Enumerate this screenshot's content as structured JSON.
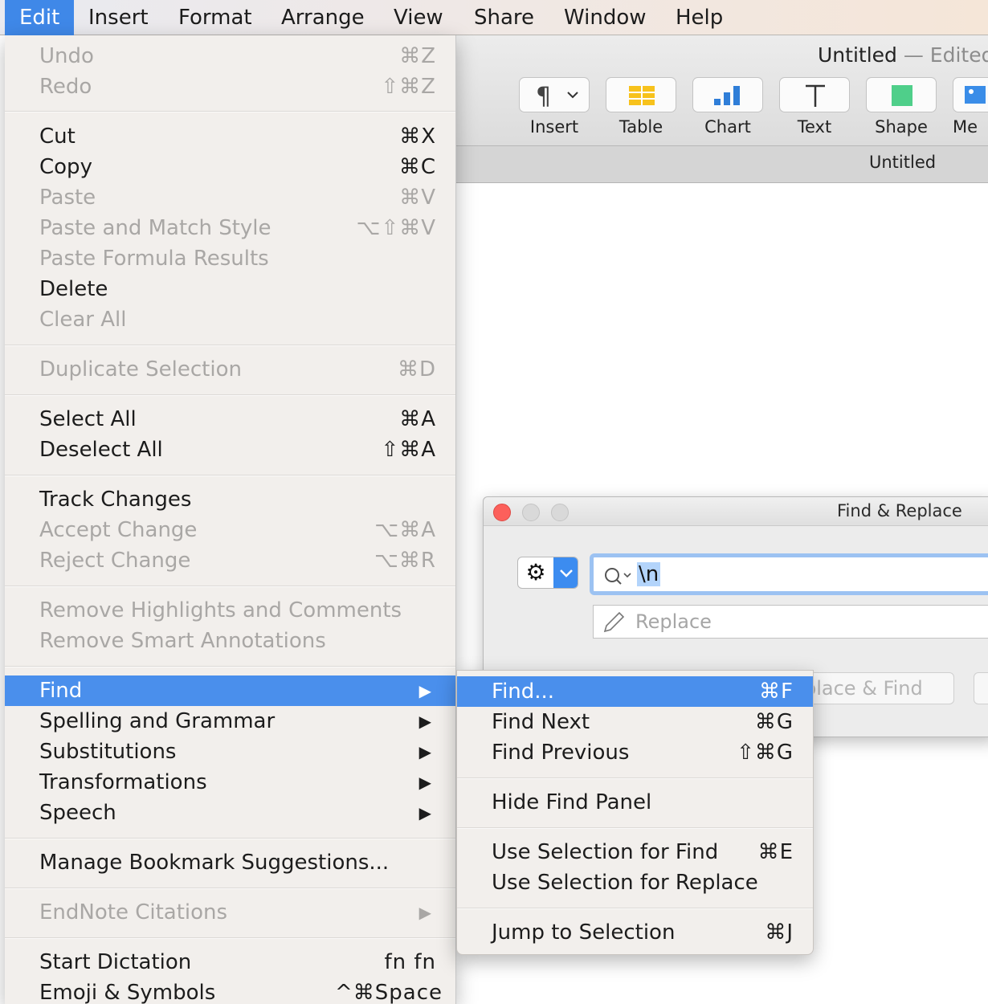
{
  "menubar": {
    "items": [
      "Edit",
      "Insert",
      "Format",
      "Arrange",
      "View",
      "Share",
      "Window",
      "Help"
    ],
    "active_index": 0
  },
  "document": {
    "title": "Untitled",
    "title_separator": "—",
    "title_status": "Edited",
    "toolbar": [
      {
        "label": "Insert",
        "icon": "paragraph-icon"
      },
      {
        "label": "Table",
        "icon": "table-icon"
      },
      {
        "label": "Chart",
        "icon": "chart-icon"
      },
      {
        "label": "Text",
        "icon": "text-icon"
      },
      {
        "label": "Shape",
        "icon": "shape-icon"
      },
      {
        "label": "Me",
        "icon": "media-icon"
      }
    ],
    "tab_title": "Untitled"
  },
  "find_panel": {
    "title": "Find & Replace",
    "search_value": "\\n",
    "replace_placeholder": "Replace",
    "replace_find_button": "place & Find"
  },
  "edit_menu": {
    "items": [
      {
        "label": "Undo",
        "shortcut": "⌘Z",
        "enabled": false
      },
      {
        "label": "Redo",
        "shortcut": "⇧⌘Z",
        "enabled": false
      },
      {
        "label": "Cut",
        "shortcut": "⌘X",
        "enabled": true
      },
      {
        "label": "Copy",
        "shortcut": "⌘C",
        "enabled": true
      },
      {
        "label": "Paste",
        "shortcut": "⌘V",
        "enabled": false
      },
      {
        "label": "Paste and Match Style",
        "shortcut": "⌥⇧⌘V",
        "enabled": false
      },
      {
        "label": "Paste Formula Results",
        "shortcut": "",
        "enabled": false
      },
      {
        "label": "Delete",
        "shortcut": "",
        "enabled": true
      },
      {
        "label": "Clear All",
        "shortcut": "",
        "enabled": false
      },
      {
        "label": "Duplicate Selection",
        "shortcut": "⌘D",
        "enabled": false
      },
      {
        "label": "Select All",
        "shortcut": "⌘A",
        "enabled": true
      },
      {
        "label": "Deselect All",
        "shortcut": "⇧⌘A",
        "enabled": true
      },
      {
        "label": "Track Changes",
        "shortcut": "",
        "enabled": true
      },
      {
        "label": "Accept Change",
        "shortcut": "⌥⌘A",
        "enabled": false
      },
      {
        "label": "Reject Change",
        "shortcut": "⌥⌘R",
        "enabled": false
      },
      {
        "label": "Remove Highlights and Comments",
        "shortcut": "",
        "enabled": false
      },
      {
        "label": "Remove Smart Annotations",
        "shortcut": "",
        "enabled": false
      },
      {
        "label": "Find",
        "shortcut": "",
        "enabled": true,
        "submenu": true,
        "highlighted": true
      },
      {
        "label": "Spelling and Grammar",
        "shortcut": "",
        "enabled": true,
        "submenu": true
      },
      {
        "label": "Substitutions",
        "shortcut": "",
        "enabled": true,
        "submenu": true
      },
      {
        "label": "Transformations",
        "shortcut": "",
        "enabled": true,
        "submenu": true
      },
      {
        "label": "Speech",
        "shortcut": "",
        "enabled": true,
        "submenu": true
      },
      {
        "label": "Manage Bookmark Suggestions...",
        "shortcut": "",
        "enabled": true
      },
      {
        "label": "EndNote Citations",
        "shortcut": "",
        "enabled": false,
        "submenu": true
      },
      {
        "label": "Start Dictation",
        "shortcut": "fn fn",
        "enabled": true
      },
      {
        "label": "Emoji & Symbols",
        "shortcut": "^⌘Space",
        "enabled": true
      }
    ]
  },
  "find_submenu": {
    "items": [
      {
        "label": "Find...",
        "shortcut": "⌘F",
        "highlighted": true
      },
      {
        "label": "Find Next",
        "shortcut": "⌘G"
      },
      {
        "label": "Find Previous",
        "shortcut": "⇧⌘G"
      },
      {
        "label": "Hide Find Panel",
        "shortcut": ""
      },
      {
        "label": "Use Selection for Find",
        "shortcut": "⌘E"
      },
      {
        "label": "Use Selection for Replace",
        "shortcut": ""
      },
      {
        "label": "Jump to Selection",
        "shortcut": "⌘J"
      }
    ]
  },
  "colors": {
    "highlight": "#4a8fec",
    "menu_bg": "#f2efec",
    "disabled_text": "#a9a7a5",
    "close_button": "#fc605b"
  }
}
